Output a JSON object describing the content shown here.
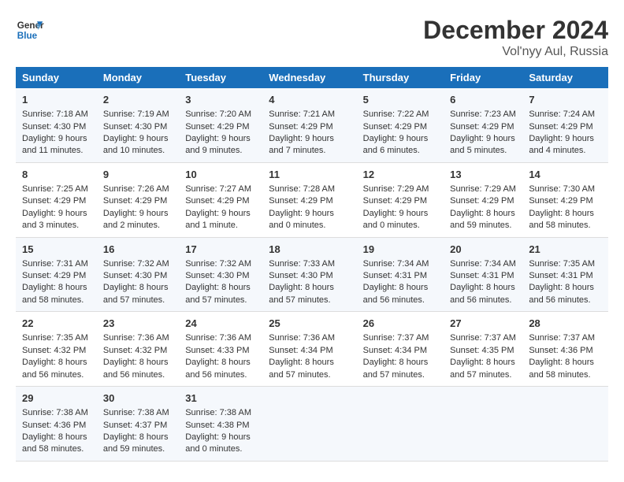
{
  "header": {
    "logo_line1": "General",
    "logo_line2": "Blue",
    "main_title": "December 2024",
    "subtitle": "Vol'nyy Aul, Russia"
  },
  "weekdays": [
    "Sunday",
    "Monday",
    "Tuesday",
    "Wednesday",
    "Thursday",
    "Friday",
    "Saturday"
  ],
  "weeks": [
    [
      {
        "day": "1",
        "sunrise": "Sunrise: 7:18 AM",
        "sunset": "Sunset: 4:30 PM",
        "daylight": "Daylight: 9 hours and 11 minutes."
      },
      {
        "day": "2",
        "sunrise": "Sunrise: 7:19 AM",
        "sunset": "Sunset: 4:30 PM",
        "daylight": "Daylight: 9 hours and 10 minutes."
      },
      {
        "day": "3",
        "sunrise": "Sunrise: 7:20 AM",
        "sunset": "Sunset: 4:29 PM",
        "daylight": "Daylight: 9 hours and 9 minutes."
      },
      {
        "day": "4",
        "sunrise": "Sunrise: 7:21 AM",
        "sunset": "Sunset: 4:29 PM",
        "daylight": "Daylight: 9 hours and 7 minutes."
      },
      {
        "day": "5",
        "sunrise": "Sunrise: 7:22 AM",
        "sunset": "Sunset: 4:29 PM",
        "daylight": "Daylight: 9 hours and 6 minutes."
      },
      {
        "day": "6",
        "sunrise": "Sunrise: 7:23 AM",
        "sunset": "Sunset: 4:29 PM",
        "daylight": "Daylight: 9 hours and 5 minutes."
      },
      {
        "day": "7",
        "sunrise": "Sunrise: 7:24 AM",
        "sunset": "Sunset: 4:29 PM",
        "daylight": "Daylight: 9 hours and 4 minutes."
      }
    ],
    [
      {
        "day": "8",
        "sunrise": "Sunrise: 7:25 AM",
        "sunset": "Sunset: 4:29 PM",
        "daylight": "Daylight: 9 hours and 3 minutes."
      },
      {
        "day": "9",
        "sunrise": "Sunrise: 7:26 AM",
        "sunset": "Sunset: 4:29 PM",
        "daylight": "Daylight: 9 hours and 2 minutes."
      },
      {
        "day": "10",
        "sunrise": "Sunrise: 7:27 AM",
        "sunset": "Sunset: 4:29 PM",
        "daylight": "Daylight: 9 hours and 1 minute."
      },
      {
        "day": "11",
        "sunrise": "Sunrise: 7:28 AM",
        "sunset": "Sunset: 4:29 PM",
        "daylight": "Daylight: 9 hours and 0 minutes."
      },
      {
        "day": "12",
        "sunrise": "Sunrise: 7:29 AM",
        "sunset": "Sunset: 4:29 PM",
        "daylight": "Daylight: 9 hours and 0 minutes."
      },
      {
        "day": "13",
        "sunrise": "Sunrise: 7:29 AM",
        "sunset": "Sunset: 4:29 PM",
        "daylight": "Daylight: 8 hours and 59 minutes."
      },
      {
        "day": "14",
        "sunrise": "Sunrise: 7:30 AM",
        "sunset": "Sunset: 4:29 PM",
        "daylight": "Daylight: 8 hours and 58 minutes."
      }
    ],
    [
      {
        "day": "15",
        "sunrise": "Sunrise: 7:31 AM",
        "sunset": "Sunset: 4:29 PM",
        "daylight": "Daylight: 8 hours and 58 minutes."
      },
      {
        "day": "16",
        "sunrise": "Sunrise: 7:32 AM",
        "sunset": "Sunset: 4:30 PM",
        "daylight": "Daylight: 8 hours and 57 minutes."
      },
      {
        "day": "17",
        "sunrise": "Sunrise: 7:32 AM",
        "sunset": "Sunset: 4:30 PM",
        "daylight": "Daylight: 8 hours and 57 minutes."
      },
      {
        "day": "18",
        "sunrise": "Sunrise: 7:33 AM",
        "sunset": "Sunset: 4:30 PM",
        "daylight": "Daylight: 8 hours and 57 minutes."
      },
      {
        "day": "19",
        "sunrise": "Sunrise: 7:34 AM",
        "sunset": "Sunset: 4:31 PM",
        "daylight": "Daylight: 8 hours and 56 minutes."
      },
      {
        "day": "20",
        "sunrise": "Sunrise: 7:34 AM",
        "sunset": "Sunset: 4:31 PM",
        "daylight": "Daylight: 8 hours and 56 minutes."
      },
      {
        "day": "21",
        "sunrise": "Sunrise: 7:35 AM",
        "sunset": "Sunset: 4:31 PM",
        "daylight": "Daylight: 8 hours and 56 minutes."
      }
    ],
    [
      {
        "day": "22",
        "sunrise": "Sunrise: 7:35 AM",
        "sunset": "Sunset: 4:32 PM",
        "daylight": "Daylight: 8 hours and 56 minutes."
      },
      {
        "day": "23",
        "sunrise": "Sunrise: 7:36 AM",
        "sunset": "Sunset: 4:32 PM",
        "daylight": "Daylight: 8 hours and 56 minutes."
      },
      {
        "day": "24",
        "sunrise": "Sunrise: 7:36 AM",
        "sunset": "Sunset: 4:33 PM",
        "daylight": "Daylight: 8 hours and 56 minutes."
      },
      {
        "day": "25",
        "sunrise": "Sunrise: 7:36 AM",
        "sunset": "Sunset: 4:34 PM",
        "daylight": "Daylight: 8 hours and 57 minutes."
      },
      {
        "day": "26",
        "sunrise": "Sunrise: 7:37 AM",
        "sunset": "Sunset: 4:34 PM",
        "daylight": "Daylight: 8 hours and 57 minutes."
      },
      {
        "day": "27",
        "sunrise": "Sunrise: 7:37 AM",
        "sunset": "Sunset: 4:35 PM",
        "daylight": "Daylight: 8 hours and 57 minutes."
      },
      {
        "day": "28",
        "sunrise": "Sunrise: 7:37 AM",
        "sunset": "Sunset: 4:36 PM",
        "daylight": "Daylight: 8 hours and 58 minutes."
      }
    ],
    [
      {
        "day": "29",
        "sunrise": "Sunrise: 7:38 AM",
        "sunset": "Sunset: 4:36 PM",
        "daylight": "Daylight: 8 hours and 58 minutes."
      },
      {
        "day": "30",
        "sunrise": "Sunrise: 7:38 AM",
        "sunset": "Sunset: 4:37 PM",
        "daylight": "Daylight: 8 hours and 59 minutes."
      },
      {
        "day": "31",
        "sunrise": "Sunrise: 7:38 AM",
        "sunset": "Sunset: 4:38 PM",
        "daylight": "Daylight: 9 hours and 0 minutes."
      },
      null,
      null,
      null,
      null
    ]
  ]
}
